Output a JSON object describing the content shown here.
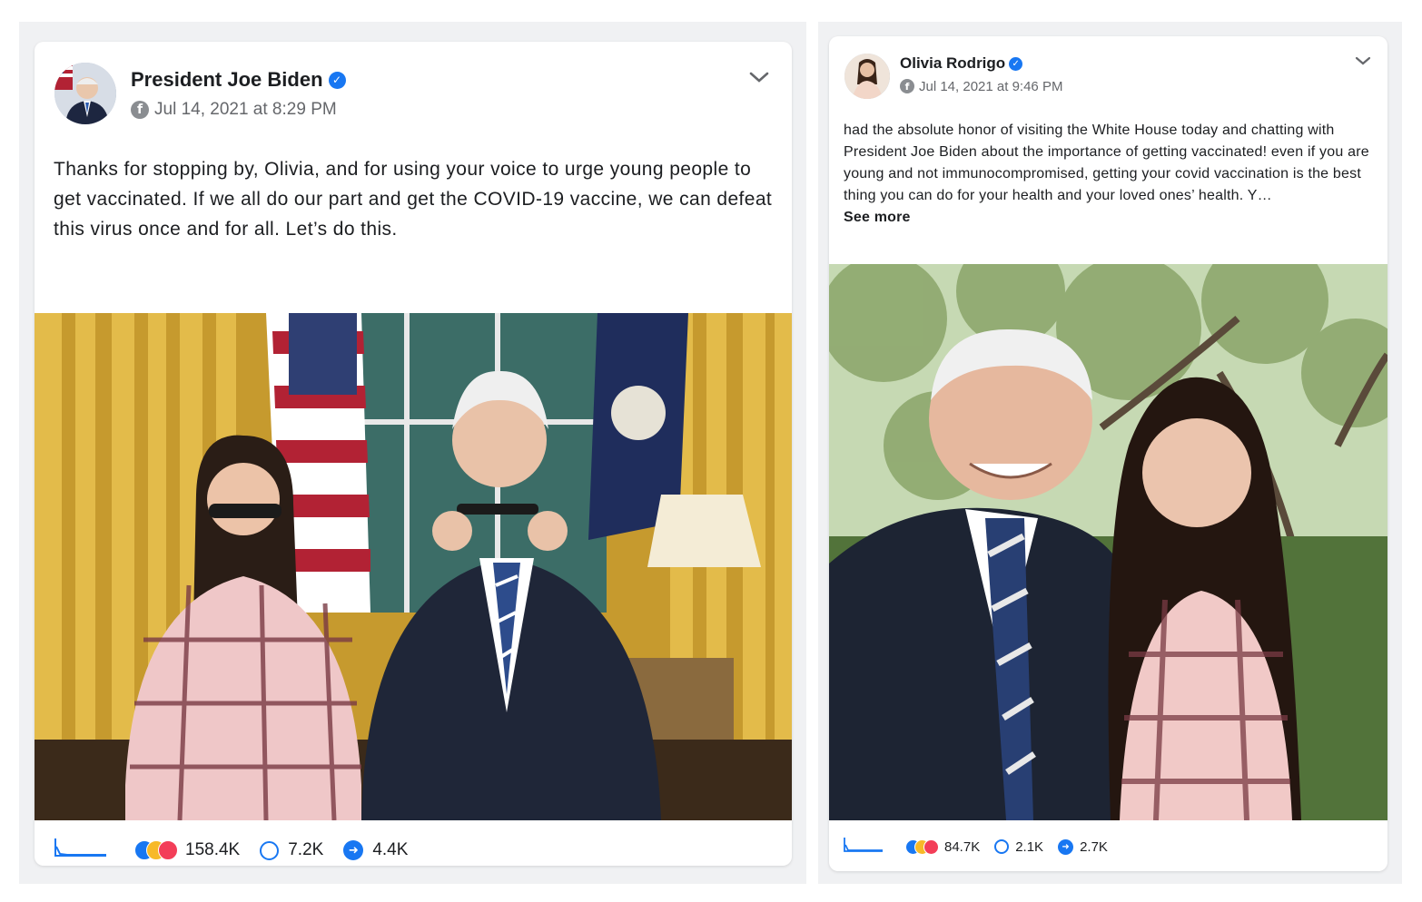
{
  "posts": [
    {
      "author": "President Joe Biden",
      "verified": true,
      "timestamp": "Jul 14, 2021 at 8:29 PM",
      "text": "Thanks for stopping by, Olivia, and for using your voice to urge young people to get vaccinated. If we all do our part and get the COVID-19 vaccine, we can defeat this virus once and for all. Let’s do this.",
      "stats": {
        "reactions": "158.4K",
        "comments": "7.2K",
        "shares": "4.4K"
      }
    },
    {
      "author": "Olivia Rodrigo",
      "verified": true,
      "timestamp": "Jul 14, 2021 at 9:46 PM",
      "text": "had the absolute honor of visiting the White House today and chatting with President Joe Biden about the importance of getting vaccinated! even if you are young and not immunocompromised, getting your covid vaccination is the best thing you can do for your health and your loved ones’ health. Y…",
      "see_more": "See more",
      "stats": {
        "reactions": "84.7K",
        "comments": "2.1K",
        "shares": "2.7K"
      }
    }
  ],
  "icons": {
    "verified": "check-badge",
    "platform": "facebook-logo",
    "menu": "chevron-down",
    "reactions": "like-love-haha",
    "comments": "speech-bubble",
    "shares": "share-arrow",
    "trend": "sparkline"
  },
  "colors": {
    "accent": "#1877f2",
    "text": "#1c1e21",
    "muted": "#65676b",
    "panel_bg": "#f0f1f3"
  }
}
